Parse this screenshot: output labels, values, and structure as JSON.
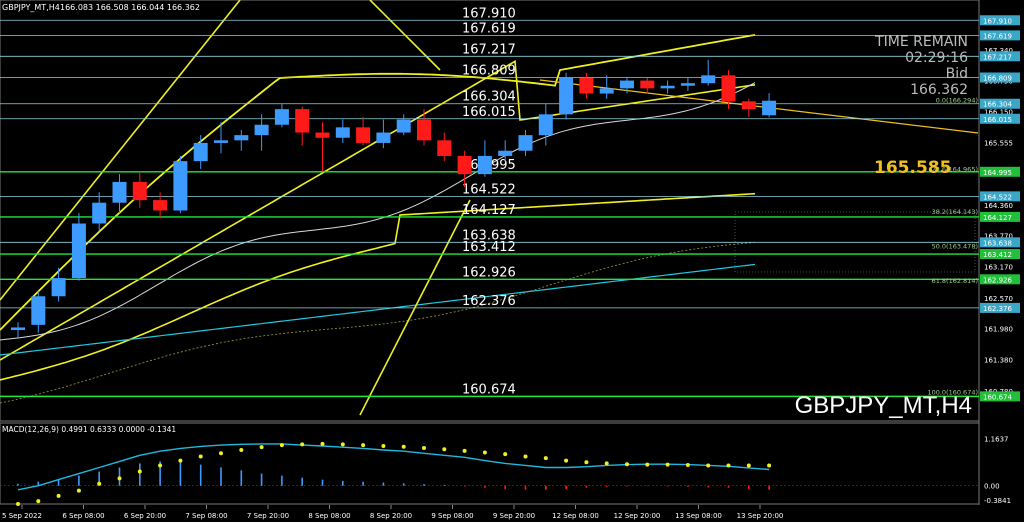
{
  "header": {
    "symbol_info": "GBPJPY_MT,H4",
    "ohlc": "166.083 166.508 166.044 166.362"
  },
  "time_remain": {
    "label": "TIME REMAIN",
    "value": "02:29:16",
    "bid_label": "Bid",
    "bid_value": "166.362"
  },
  "watermark": "GBPJPY_MT,H4",
  "highlight_price": "165.585",
  "colors": {
    "background": "#000000",
    "bull": "#3d9bff",
    "bear": "#ff1a1a",
    "level_line": "#8fd3e0",
    "green_line": "#22e63a",
    "bollinger": "#f0f020",
    "ma_white": "#d8d8d8",
    "ma_cyan": "#20c8e0",
    "macd_signal": "#f0f020",
    "macd_line": "#20b8e0"
  },
  "chart_data": [
    {
      "type": "candlestick",
      "title": "GBPJPY_MT,H4",
      "x_ticks": [
        "5 Sep 2022",
        "6 Sep 08:00",
        "6 Sep 20:00",
        "7 Sep 08:00",
        "7 Sep 20:00",
        "8 Sep 08:00",
        "8 Sep 20:00",
        "9 Sep 08:00",
        "9 Sep 20:00",
        "12 Sep 08:00",
        "12 Sep 20:00",
        "13 Sep 08:00",
        "13 Sep 20:00"
      ],
      "ylim": [
        160.2,
        168.3
      ],
      "y_axis_ticks": [
        "167.340",
        "166.750",
        "166.150",
        "165.555",
        "164.360",
        "163.770",
        "163.170",
        "162.570",
        "161.980",
        "161.380",
        "160.780"
      ],
      "horizontal_levels": [
        {
          "price": 167.91,
          "label": "167.910",
          "axis_label": "167.910",
          "color": "teal"
        },
        {
          "price": 167.619,
          "label": "167.619",
          "axis_label": "167.619",
          "color": "teal"
        },
        {
          "price": 167.217,
          "label": "167.217",
          "axis_label": "167.217",
          "color": "teal"
        },
        {
          "price": 166.809,
          "label": "166.809",
          "axis_label": "166.809",
          "color": "teal"
        },
        {
          "price": 166.304,
          "label": "166.304",
          "axis_label": "166.304",
          "color": "teal"
        },
        {
          "price": 166.015,
          "label": "166.015",
          "axis_label": "166.015",
          "color": "teal"
        },
        {
          "price": 164.995,
          "label": "164.995",
          "axis_label": "164.995",
          "color": "green"
        },
        {
          "price": 164.522,
          "label": "164.522",
          "axis_label": "164.522",
          "color": "teal"
        },
        {
          "price": 164.127,
          "label": "164.127",
          "axis_label": "164.127",
          "color": "green"
        },
        {
          "price": 163.638,
          "label": "163.638",
          "axis_label": "163.638",
          "color": "teal"
        },
        {
          "price": 163.412,
          "label": "163.412",
          "axis_label": "163.412",
          "color": "green"
        },
        {
          "price": 162.926,
          "label": "162.926",
          "axis_label": "162.926",
          "color": "green"
        },
        {
          "price": 162.376,
          "label": "162.376",
          "axis_label": "162.376",
          "color": "teal"
        },
        {
          "price": 160.674,
          "label": "160.674",
          "axis_label": "160.674",
          "color": "green"
        }
      ],
      "fib_levels": [
        {
          "price": 166.294,
          "label": "0.0(166.294)"
        },
        {
          "price": 164.965,
          "label": "23.6(164.965)"
        },
        {
          "price": 164.143,
          "label": "38.2(164.143)"
        },
        {
          "price": 163.478,
          "label": "50.0(163.478)"
        },
        {
          "price": 162.814,
          "label": "61.8(162.814)"
        },
        {
          "price": 160.674,
          "label": "100.0(160.674)"
        }
      ],
      "candles": [
        {
          "o": 161.95,
          "h": 162.1,
          "l": 161.8,
          "c": 162.0
        },
        {
          "o": 162.05,
          "h": 162.7,
          "l": 161.9,
          "c": 162.6
        },
        {
          "o": 162.6,
          "h": 163.15,
          "l": 162.5,
          "c": 162.95
        },
        {
          "o": 162.95,
          "h": 164.2,
          "l": 162.9,
          "c": 164.0
        },
        {
          "o": 164.0,
          "h": 164.6,
          "l": 163.85,
          "c": 164.4
        },
        {
          "o": 164.4,
          "h": 164.95,
          "l": 164.2,
          "c": 164.8
        },
        {
          "o": 164.8,
          "h": 165.0,
          "l": 164.3,
          "c": 164.45
        },
        {
          "o": 164.45,
          "h": 164.6,
          "l": 164.1,
          "c": 164.25
        },
        {
          "o": 164.25,
          "h": 165.3,
          "l": 164.2,
          "c": 165.2
        },
        {
          "o": 165.2,
          "h": 165.7,
          "l": 165.05,
          "c": 165.55
        },
        {
          "o": 165.55,
          "h": 165.95,
          "l": 165.35,
          "c": 165.6
        },
        {
          "o": 165.6,
          "h": 165.8,
          "l": 165.4,
          "c": 165.7
        },
        {
          "o": 165.7,
          "h": 166.1,
          "l": 165.4,
          "c": 165.9
        },
        {
          "o": 165.9,
          "h": 166.3,
          "l": 165.85,
          "c": 166.2
        },
        {
          "o": 166.2,
          "h": 166.25,
          "l": 165.5,
          "c": 165.75
        },
        {
          "o": 165.75,
          "h": 165.95,
          "l": 165.0,
          "c": 165.65
        },
        {
          "o": 165.65,
          "h": 166.0,
          "l": 165.55,
          "c": 165.85
        },
        {
          "o": 165.85,
          "h": 166.05,
          "l": 165.5,
          "c": 165.55
        },
        {
          "o": 165.55,
          "h": 166.0,
          "l": 165.45,
          "c": 165.75
        },
        {
          "o": 165.75,
          "h": 166.1,
          "l": 165.7,
          "c": 166.0
        },
        {
          "o": 166.0,
          "h": 166.2,
          "l": 165.5,
          "c": 165.6
        },
        {
          "o": 165.6,
          "h": 165.75,
          "l": 165.2,
          "c": 165.3
        },
        {
          "o": 165.3,
          "h": 165.4,
          "l": 164.7,
          "c": 164.95
        },
        {
          "o": 164.95,
          "h": 165.6,
          "l": 164.9,
          "c": 165.3
        },
        {
          "o": 165.3,
          "h": 165.6,
          "l": 165.2,
          "c": 165.4
        },
        {
          "o": 165.4,
          "h": 165.8,
          "l": 165.3,
          "c": 165.7
        },
        {
          "o": 165.7,
          "h": 166.3,
          "l": 165.5,
          "c": 166.1
        },
        {
          "o": 166.1,
          "h": 166.9,
          "l": 166.0,
          "c": 166.8
        },
        {
          "o": 166.8,
          "h": 166.9,
          "l": 166.4,
          "c": 166.5
        },
        {
          "o": 166.5,
          "h": 166.85,
          "l": 166.4,
          "c": 166.6
        },
        {
          "o": 166.6,
          "h": 166.8,
          "l": 166.5,
          "c": 166.75
        },
        {
          "o": 166.75,
          "h": 166.8,
          "l": 166.5,
          "c": 166.6
        },
        {
          "o": 166.6,
          "h": 166.75,
          "l": 166.5,
          "c": 166.65
        },
        {
          "o": 166.65,
          "h": 166.8,
          "l": 166.55,
          "c": 166.7
        },
        {
          "o": 166.7,
          "h": 167.15,
          "l": 166.65,
          "c": 166.85
        },
        {
          "o": 166.85,
          "h": 166.95,
          "l": 166.2,
          "c": 166.35
        },
        {
          "o": 166.35,
          "h": 166.4,
          "l": 166.05,
          "c": 166.2
        },
        {
          "o": 166.083,
          "h": 166.508,
          "l": 166.044,
          "c": 166.362
        }
      ],
      "annotations": [
        "165.585",
        "TIME REMAIN",
        "02:29:16",
        "Bid",
        "166.362"
      ]
    },
    {
      "type": "histogram",
      "title": "MACD(12,26,9) 0.4991 0.6333 0.0000 -0.1341",
      "ylim": [
        -0.45,
        1.25
      ],
      "y_axis_ticks": [
        "1.1637",
        "0.00",
        "-0.3841"
      ],
      "histogram": [
        0.05,
        0.1,
        0.15,
        0.25,
        0.35,
        0.45,
        0.55,
        0.6,
        0.58,
        0.52,
        0.45,
        0.38,
        0.3,
        0.25,
        0.2,
        0.15,
        0.12,
        0.1,
        0.08,
        0.06,
        0.04,
        0.02,
        -0.02,
        -0.05,
        -0.08,
        -0.1,
        -0.1,
        -0.08,
        -0.05,
        -0.03,
        -0.02,
        -0.01,
        -0.02,
        -0.03,
        -0.04,
        -0.05,
        -0.08,
        -0.1
      ],
      "macd_line": [
        -0.1,
        0.0,
        0.15,
        0.3,
        0.45,
        0.6,
        0.75,
        0.85,
        0.92,
        0.97,
        1.0,
        1.02,
        1.03,
        1.03,
        1.0,
        0.98,
        0.95,
        0.92,
        0.88,
        0.85,
        0.8,
        0.75,
        0.7,
        0.62,
        0.55,
        0.5,
        0.45,
        0.45,
        0.47,
        0.5,
        0.52,
        0.53,
        0.53,
        0.52,
        0.5,
        0.48,
        0.44,
        0.4
      ],
      "signal_dots": [
        -0.45,
        -0.38,
        -0.25,
        -0.12,
        0.05,
        0.18,
        0.35,
        0.5,
        0.62,
        0.72,
        0.8,
        0.88,
        0.95,
        1.0,
        1.02,
        1.03,
        1.02,
        1.0,
        0.98,
        0.96,
        0.93,
        0.9,
        0.86,
        0.82,
        0.78,
        0.72,
        0.68,
        0.62,
        0.58,
        0.55,
        0.53,
        0.52,
        0.52,
        0.51,
        0.5,
        0.5,
        0.5,
        0.5
      ]
    }
  ]
}
